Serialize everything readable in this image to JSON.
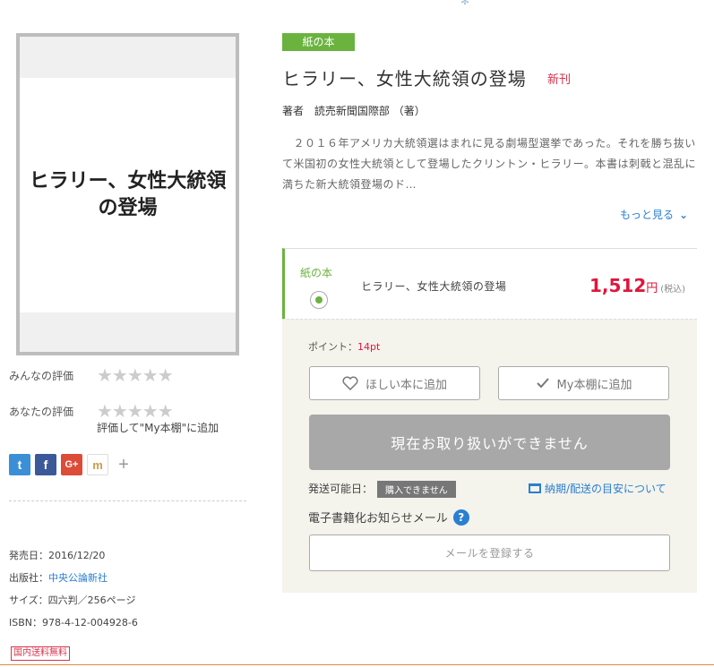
{
  "cover": {
    "title_line1": "ヒラリー、女性大統領",
    "title_line2": "の登場"
  },
  "ratings": {
    "everyone_label": "みんなの評価",
    "your_label": "あなたの評価",
    "stars": "★★★★★",
    "rate_hint": "評価して\"My本棚\"に追加"
  },
  "social": {
    "twitter": "t",
    "facebook": "f",
    "googleplus": "G+",
    "mixi": "m",
    "more": "+"
  },
  "meta": {
    "release": "発売日：2016/12/20",
    "publisher_label": "出版社：",
    "publisher": "中央公論新社",
    "size": "サイズ：四六判／256ページ",
    "isbn": "ISBN：978-4-12-004928-6",
    "free_shipping": "国内送料無料"
  },
  "book": {
    "badge": "紙の本",
    "title": "ヒラリー、女性大統領の登場",
    "new_label": "新刊",
    "author_label": "著者",
    "author": "読売新聞国際部",
    "author_role": "（著）",
    "description": "　２０１６年アメリカ大統領選はまれに見る劇場型選挙であった。それを勝ち抜いて米国初の女性大統領として登場したクリントン・ヒラリー。本書は刺戟と混乱に満ちた新大統領登場のド…",
    "more_label": "もっと見る"
  },
  "format": {
    "label": "紙の本",
    "title": "ヒラリー、女性大統領の登場",
    "price": "1,512",
    "currency": "円",
    "tax": "(税込)"
  },
  "purchase": {
    "points_label": "ポイント：",
    "points_value": "14pt",
    "wish_label": "ほしい本に追加",
    "shelf_label": "My本棚に追加",
    "unavailable_label": "現在お取り扱いができません",
    "ship_label": "発送可能日：",
    "ship_status": "購入できません",
    "ship_link": "納期/配送の目安について",
    "ebook_label": "電子書籍化お知らせメール",
    "mail_button": "メールを登録する"
  },
  "colors": {
    "accent_green": "#6ab33f",
    "price_red": "#e0163b",
    "link_blue": "#2a7fd0"
  }
}
